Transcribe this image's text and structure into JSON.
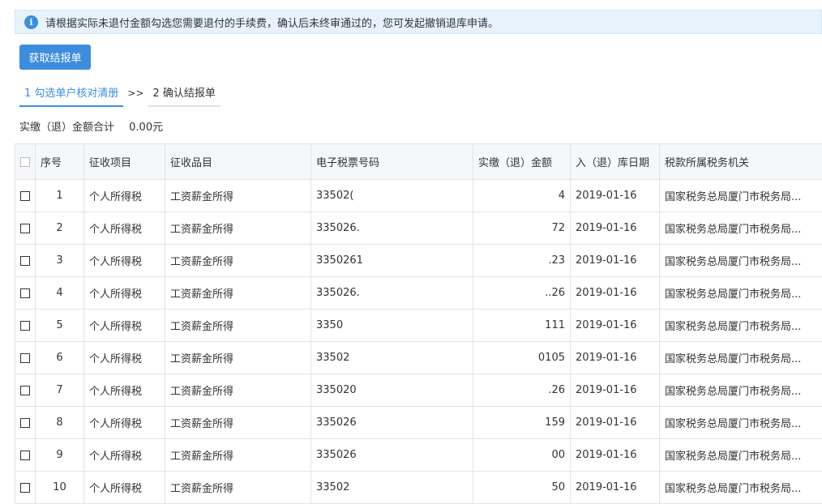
{
  "notice": {
    "icon": "info-icon",
    "text": "请根据实际未退付金额勾选您需要退付的手续费，确认后未终审通过的，您可发起撤销退库申请。"
  },
  "fetch_button": "获取结报单",
  "steps": {
    "step1": "1 勾选单户核对清册",
    "separator": ">>",
    "step2": "2 确认结报单"
  },
  "summary": {
    "label": "实缴（退）金额合计",
    "amount": "0.00元"
  },
  "table": {
    "headers": {
      "seq": "序号",
      "item": "征收项目",
      "subitem": "征收品目",
      "ticket": "电子税票号码",
      "amount": "实缴（退）金额",
      "date": "入（退）库日期",
      "office": "税款所属税务机关"
    },
    "rows": [
      {
        "seq": "1",
        "item": "个人所得税",
        "subitem": "工资薪金所得",
        "ticket": "33502(",
        "amount": "4",
        "date": "2019-01-16",
        "office": "国家税务总局厦门市税务局..."
      },
      {
        "seq": "2",
        "item": "个人所得税",
        "subitem": "工资薪金所得",
        "ticket": "335026.",
        "amount": "72",
        "date": "2019-01-16",
        "office": "国家税务总局厦门市税务局..."
      },
      {
        "seq": "3",
        "item": "个人所得税",
        "subitem": "工资薪金所得",
        "ticket": "3350261",
        "amount": ".23",
        "date": "2019-01-16",
        "office": "国家税务总局厦门市税务局..."
      },
      {
        "seq": "4",
        "item": "个人所得税",
        "subitem": "工资薪金所得",
        "ticket": "335026.",
        "amount": "..26",
        "date": "2019-01-16",
        "office": "国家税务总局厦门市税务局..."
      },
      {
        "seq": "5",
        "item": "个人所得税",
        "subitem": "工资薪金所得",
        "ticket": "3350",
        "amount": "111",
        "date": "2019-01-16",
        "office": "国家税务总局厦门市税务局..."
      },
      {
        "seq": "6",
        "item": "个人所得税",
        "subitem": "工资薪金所得",
        "ticket": "33502",
        "amount": "0105",
        "date": "2019-01-16",
        "office": "国家税务总局厦门市税务局..."
      },
      {
        "seq": "7",
        "item": "个人所得税",
        "subitem": "工资薪金所得",
        "ticket": "335020",
        "amount": ".26",
        "date": "2019-01-16",
        "office": "国家税务总局厦门市税务局..."
      },
      {
        "seq": "8",
        "item": "个人所得税",
        "subitem": "工资薪金所得",
        "ticket": "335026",
        "amount": "159",
        "date": "2019-01-16",
        "office": "国家税务总局厦门市税务局..."
      },
      {
        "seq": "9",
        "item": "个人所得税",
        "subitem": "工资薪金所得",
        "ticket": "335026",
        "amount": "00",
        "date": "2019-01-16",
        "office": "国家税务总局厦门市税务局..."
      },
      {
        "seq": "10",
        "item": "个人所得税",
        "subitem": "工资薪金所得",
        "ticket": "33502",
        "amount": "50",
        "date": "2019-01-16",
        "office": "国家税务总局厦门市税务局..."
      }
    ]
  },
  "colors": {
    "accent": "#3d8ddf",
    "notice_bg": "#e8f2fc"
  }
}
